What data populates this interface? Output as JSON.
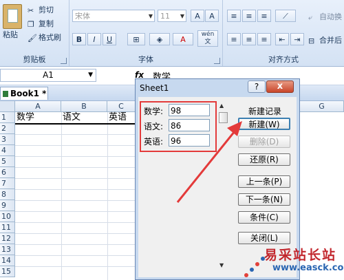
{
  "ribbon": {
    "clipboard": {
      "paste": "粘贴",
      "cut": "剪切",
      "copy": "复制",
      "format_painter": "格式刷",
      "label": "剪贴板"
    },
    "font": {
      "font_name": "宋体",
      "font_size": "11",
      "label": "字体",
      "bold": "B",
      "italic": "I",
      "underline": "U",
      "grow": "A",
      "shrink": "A",
      "font_color": "A",
      "phonetic": "wén"
    },
    "alignment": {
      "label": "对齐方式",
      "wrap": "自动换",
      "merge": "合并后"
    }
  },
  "formula_bar": {
    "name_box": "A1",
    "fx": "fx",
    "content": "数学"
  },
  "workbook": {
    "tab": "Book1 *"
  },
  "grid": {
    "columns": [
      "A",
      "B",
      "C",
      "G"
    ],
    "rows": [
      "1",
      "2",
      "3",
      "4",
      "5",
      "6",
      "7",
      "8",
      "9",
      "10",
      "11",
      "12",
      "13",
      "14",
      "15"
    ],
    "row1": [
      "数学",
      "语文",
      "英语"
    ]
  },
  "dialog": {
    "title": "Sheet1",
    "help": "?",
    "close": "x",
    "fields": [
      {
        "label": "数学:",
        "value": "98"
      },
      {
        "label": "语文:",
        "value": "86"
      },
      {
        "label": "英语:",
        "value": "96"
      }
    ],
    "record_label": "新建记录",
    "buttons": {
      "new": "新建(W)",
      "delete": "删除(D)",
      "restore": "还原(R)",
      "prev": "上一条(P)",
      "next": "下一条(N)",
      "criteria": "条件(C)",
      "close": "关闭(L)"
    }
  },
  "watermark": {
    "name": "易采站长站",
    "url": "www.easck.com"
  },
  "colors": {
    "accent_red": "#e33a3a",
    "ribbon": "#d4e2f4"
  }
}
